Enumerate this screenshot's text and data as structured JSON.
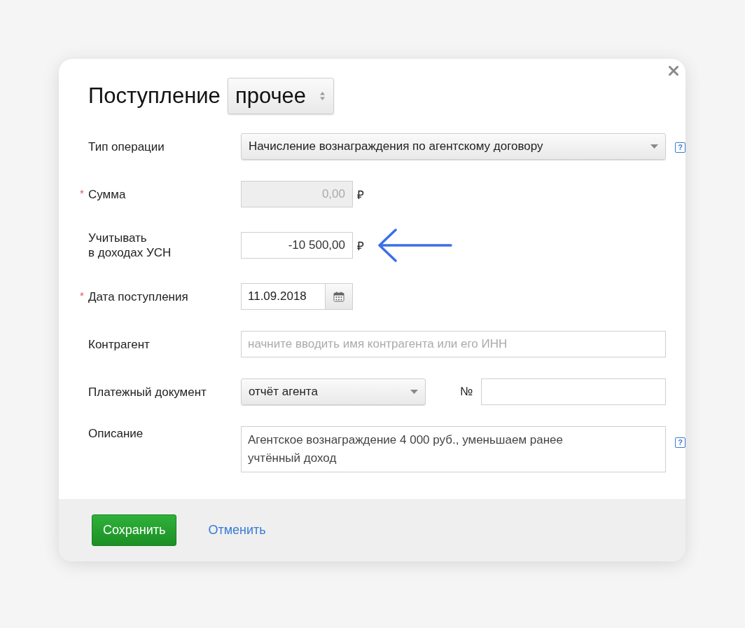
{
  "dialog": {
    "title": "Поступление",
    "type_select": {
      "value": "прочее"
    },
    "fields": [
      {
        "kind": "select",
        "label": "Тип операции",
        "value": "Начисление вознаграждения по агентскому договору",
        "help": "?"
      },
      {
        "kind": "amount",
        "label": "Сумма",
        "required_mark": "*",
        "value": "0,00",
        "currency": "₽",
        "disabled": true
      },
      {
        "kind": "amount",
        "label": "Учитывать\nв доходах УСН",
        "value": "-10 500,00",
        "currency": "₽",
        "disabled": false,
        "pointer_arrow": true
      },
      {
        "kind": "date",
        "label": "Дата поступления",
        "required_mark": "*",
        "value": "11.09.2018"
      },
      {
        "kind": "autocomplete",
        "label": "Контрагент",
        "placeholder": "начните вводить имя контрагента или его ИНН"
      },
      {
        "kind": "document",
        "label": "Платежный документ",
        "value": "отчёт агента",
        "number_label": "№"
      },
      {
        "kind": "textarea",
        "label": "Описание",
        "value": "Агентское вознаграждение 4 000 руб., уменьшаем ранее учтённый доход",
        "help": "?"
      }
    ],
    "buttons": [
      {
        "kind": "primary",
        "label": "Сохранить"
      },
      {
        "kind": "link",
        "label": "Отменить"
      }
    ]
  }
}
